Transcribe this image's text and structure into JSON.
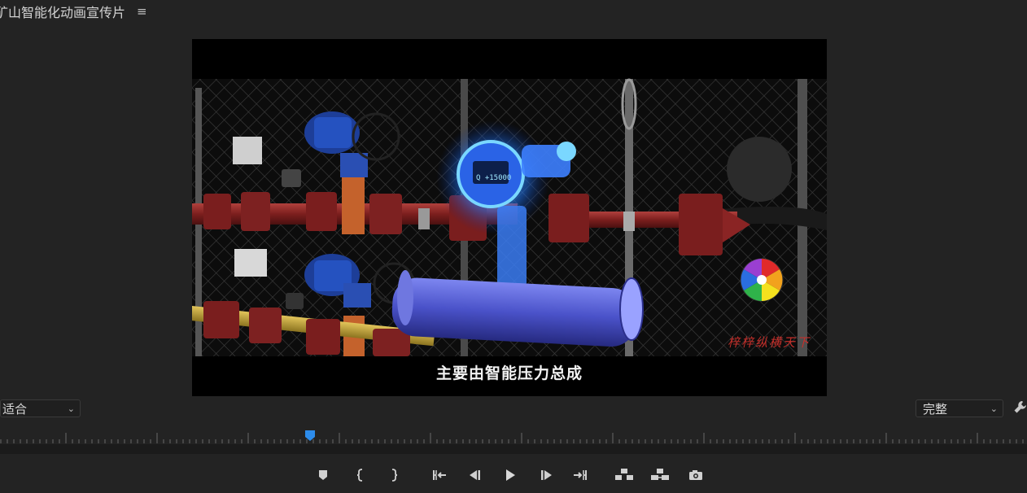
{
  "panel": {
    "title": "矿山智能化动画宣传片",
    "menu_icon": "hamburger-menu-icon"
  },
  "video": {
    "subtitle": "主要由智能压力总成",
    "watermark_logo": "colorful-circle-logo",
    "watermark_text": "梓梓纵横天下",
    "device_display": "Q +15000"
  },
  "fit_select": {
    "value": "适合"
  },
  "quality_select": {
    "value": "完整"
  },
  "settings_icon": "wrench-icon",
  "playhead": {
    "color": "#2d8ceb"
  },
  "transport": {
    "buttons": [
      "add-marker-icon",
      "mark-in-icon",
      "mark-out-icon",
      "go-to-in-icon",
      "step-back-icon",
      "play-icon",
      "step-forward-icon",
      "go-to-out-icon",
      "lift-icon",
      "extract-icon",
      "export-frame-icon"
    ]
  },
  "colors": {
    "background": "#232323",
    "accent": "#2d8ceb"
  }
}
